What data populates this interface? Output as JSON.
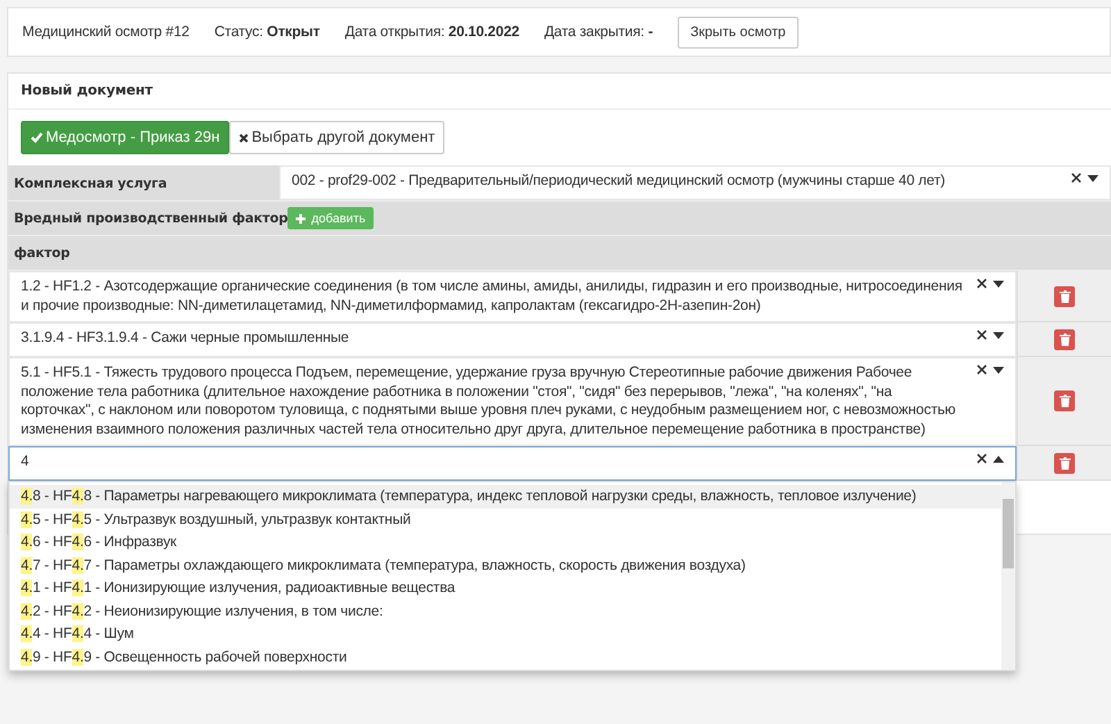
{
  "exam": {
    "title": "Медицинский осмотр #12",
    "status": "Статус: **Открыт**",
    "opened": "Дата открытия: **20.10.2022**",
    "closed": "Дата закрытия: **-**",
    "close_button": "Зкрыть осмотр"
  },
  "document": {
    "title": "Новый документ",
    "buttons": [
      {
        "label": "Медосмотр - Приказ 29н",
        "selected": true,
        "kind": "check"
      },
      {
        "label": "Выбрать другой документ",
        "selected": false,
        "kind": "cross"
      }
    ]
  },
  "service": {
    "label": "Комплексная услуга",
    "value": "002 - prof29-002 - Предварительный/периодический медицинский осмотр (мужчины старше 40 лет)"
  },
  "factors": {
    "label": "Вредный производственный фактор",
    "add_button": "добавить",
    "column": "фактор",
    "rows": [
      {
        "value": "1.2 - HF1.2 - Азотсодержащие органические соединения (в том числе амины, амиды, анилиды, гидразин и его производные, нитросоединения и прочие производные: NN-диметилацетамид, NN-диметилформамид, капролактам (гексагидро-2Н-азепин-2он)",
        "open": false
      },
      {
        "value": "3.1.9.4 - HF3.1.9.4 - Сажи черные промышленные",
        "open": false
      },
      {
        "value": "5.1 - HF5.1 - Тяжесть трудового процесса Подъем, перемещение, удержание груза вручную Стереотипные рабочие движения Рабочее положение тела работника (длительное нахождение работника в положении \"стоя\", \"сидя\" без перерывов, \"лежа\", \"на коленях\", \"на корточках\", с наклоном или поворотом туловища, с поднятыми выше уровня плеч руками, с неудобным размещением ног, с невозможностью изменения взаимного положения различных частей тела относительно друг друга, длительное перемещение работника в пространстве)",
        "open": false
      },
      {
        "value": "4",
        "open": true
      }
    ],
    "options": [
      {
        "selected": true,
        "parts": [
          {
            "text": "4.",
            "match": true
          },
          {
            "text": "8 - HF",
            "match": false
          },
          {
            "text": "4.",
            "match": true
          },
          {
            "text": "8 - Параметры нагревающего микроклимата (температура, индекс тепловой нагрузки среды, влажность, тепловое излучение)",
            "match": false
          }
        ]
      },
      {
        "selected": false,
        "parts": [
          {
            "text": "4.",
            "match": true
          },
          {
            "text": "5 - HF",
            "match": false
          },
          {
            "text": "4.",
            "match": true
          },
          {
            "text": "5 - Ультразвук воздушный, ультразвук контактный",
            "match": false
          }
        ]
      },
      {
        "selected": false,
        "parts": [
          {
            "text": "4.",
            "match": true
          },
          {
            "text": "6 - HF",
            "match": false
          },
          {
            "text": "4.",
            "match": true
          },
          {
            "text": "6 - Инфразвук",
            "match": false
          }
        ]
      },
      {
        "selected": false,
        "parts": [
          {
            "text": "4.",
            "match": true
          },
          {
            "text": "7 - HF",
            "match": false
          },
          {
            "text": "4.",
            "match": true
          },
          {
            "text": "7 - Параметры охлаждающего микроклимата (температура, влажность, скорость движения воздуха)",
            "match": false
          }
        ]
      },
      {
        "selected": false,
        "parts": [
          {
            "text": "4.",
            "match": true
          },
          {
            "text": "1 - HF",
            "match": false
          },
          {
            "text": "4.",
            "match": true
          },
          {
            "text": "1 - Ионизирующие излучения, радиоактивные вещества",
            "match": false
          }
        ]
      },
      {
        "selected": false,
        "parts": [
          {
            "text": "4.",
            "match": true
          },
          {
            "text": "2 - HF",
            "match": false
          },
          {
            "text": "4.",
            "match": true
          },
          {
            "text": "2 - Неионизирующие излучения, в том числе:",
            "match": false
          }
        ]
      },
      {
        "selected": false,
        "parts": [
          {
            "text": "4.",
            "match": true
          },
          {
            "text": "4 - HF",
            "match": false
          },
          {
            "text": "4.",
            "match": true
          },
          {
            "text": "4 - Шум",
            "match": false
          }
        ]
      },
      {
        "selected": false,
        "parts": [
          {
            "text": "4.",
            "match": true
          },
          {
            "text": "9 - HF",
            "match": false
          },
          {
            "text": "4.",
            "match": true
          },
          {
            "text": "9 - Освещенность рабочей поверхности",
            "match": false
          }
        ]
      }
    ]
  }
}
